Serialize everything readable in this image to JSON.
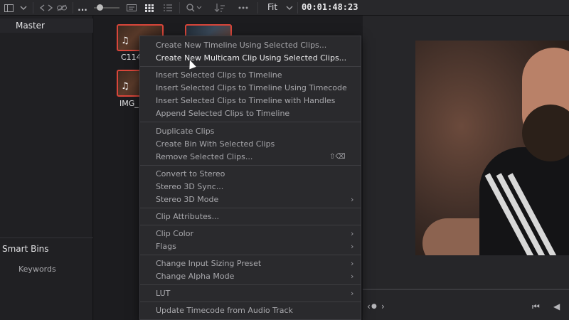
{
  "toolbar": {
    "fit_label": "Fit",
    "timecode": "00:01:48:23",
    "more_label": "...",
    "icons": [
      "panel-toggle-icon",
      "chevron-down-icon",
      "back-icon",
      "forward-icon",
      "link-icon",
      "metadata-view-icon",
      "thumbnail-view-icon",
      "list-view-icon",
      "search-icon",
      "sort-icon",
      "options-icon"
    ]
  },
  "left_panel": {
    "master": "Master",
    "smart_bins": "Smart Bins",
    "keywords": "Keywords"
  },
  "media_pool": {
    "clips": [
      {
        "label": "C114"
      },
      {
        "label": "IMG_1"
      }
    ]
  },
  "menu": {
    "items": [
      {
        "label": "Create New Timeline Using Selected Clips..."
      },
      {
        "label": "Create New Multicam Clip Using Selected Clips..."
      },
      {
        "label": "Insert Selected Clips to Timeline"
      },
      {
        "label": "Insert Selected Clips to Timeline Using Timecode"
      },
      {
        "label": "Insert Selected Clips to Timeline with Handles"
      },
      {
        "label": "Append Selected Clips to Timeline"
      },
      {
        "label": "Duplicate Clips"
      },
      {
        "label": "Create Bin With Selected Clips"
      },
      {
        "label": "Remove Selected Clips..."
      },
      {
        "label": "Convert to Stereo"
      },
      {
        "label": "Stereo 3D Sync..."
      },
      {
        "label": "Stereo 3D Mode"
      },
      {
        "label": "Clip Attributes..."
      },
      {
        "label": "Clip Color"
      },
      {
        "label": "Flags"
      },
      {
        "label": "Change Input Sizing Preset"
      },
      {
        "label": "Change Alpha Mode"
      },
      {
        "label": "LUT"
      },
      {
        "label": "Update Timecode from Audio Track"
      }
    ],
    "remove_shortcut": "⇧⌫"
  }
}
